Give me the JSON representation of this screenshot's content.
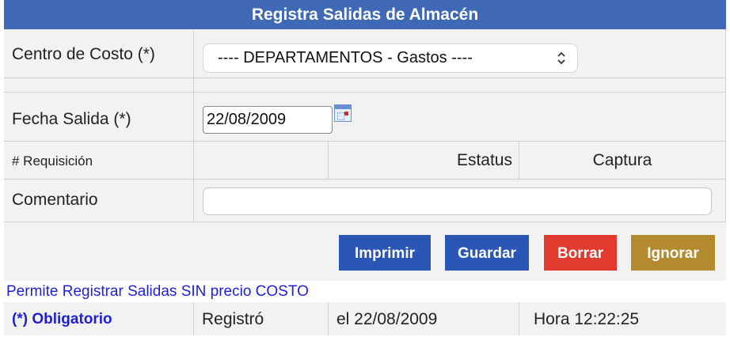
{
  "header": {
    "title": "Registra Salidas de Almacén"
  },
  "form": {
    "centro_label": "Centro de Costo (*)",
    "centro_value": "---- DEPARTAMENTOS - Gastos ----",
    "fecha_label": "Fecha Salida (*)",
    "fecha_value": "22/08/2009",
    "requisicion_label": "# Requisición",
    "estatus_label": "Estatus",
    "captura_label": "Captura",
    "comentario_label": "Comentario",
    "comentario_value": ""
  },
  "buttons": {
    "imprimir": "Imprimir",
    "guardar": "Guardar",
    "borrar": "Borrar",
    "ignorar": "Ignorar"
  },
  "colors": {
    "header_bg": "#3f68b5",
    "imprimir_bg": "#2a56b5",
    "guardar_bg": "#2a56b5",
    "borrar_bg": "#e23a2e",
    "ignorar_bg": "#b38a2d"
  },
  "footer": {
    "note": "Permite Registrar Salidas SIN precio COSTO",
    "obligatorio": "(*) Obligatorio",
    "registro": "Registró",
    "fecha": "el 22/08/2009",
    "hora": "Hora 12:22:25"
  }
}
